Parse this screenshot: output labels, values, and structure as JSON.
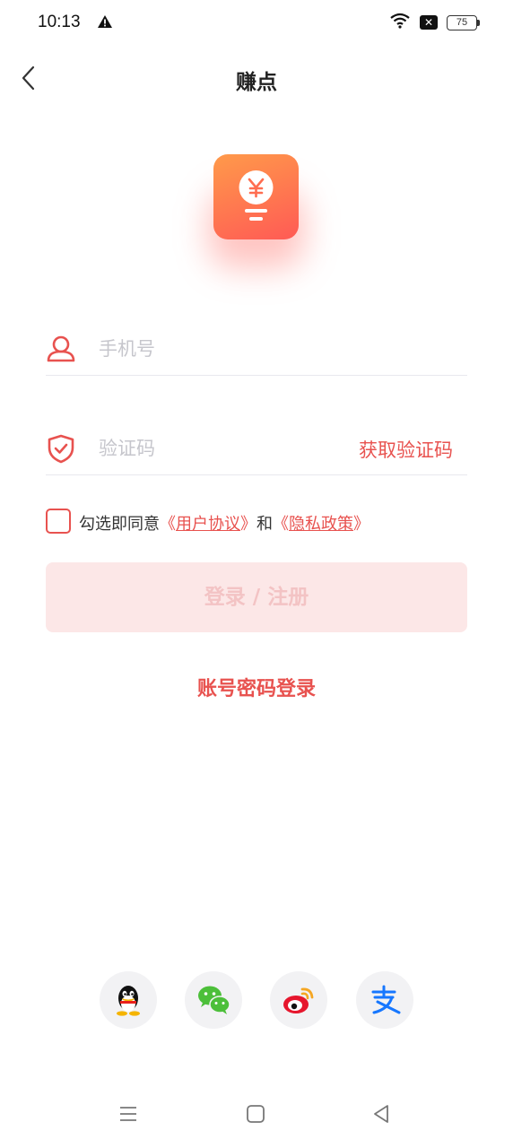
{
  "status_bar": {
    "time": "10:13",
    "battery": "75",
    "icons": [
      "alert-icon",
      "wifi-icon",
      "sim-x-icon",
      "battery-icon"
    ]
  },
  "header": {
    "title": "赚点",
    "back_icon": "chevron-left-icon"
  },
  "logo": {
    "icon": "coin-bulb-icon",
    "gradient": [
      "#ff9a4a",
      "#ff5a55"
    ]
  },
  "form": {
    "phone": {
      "placeholder": "手机号",
      "value": "",
      "icon": "user-icon"
    },
    "code": {
      "placeholder": "验证码",
      "value": "",
      "icon": "shield-check-icon",
      "get_code_label": "获取验证码"
    }
  },
  "agreement": {
    "prefix": "勾选即同意",
    "user_agreement": "用户协议",
    "connector": "和",
    "privacy_policy": "隐私政策",
    "checked": false
  },
  "login_button": {
    "label": "登录 / 注册",
    "enabled": false
  },
  "password_login_label": "账号密码登录",
  "social_logins": [
    "qq-icon",
    "wechat-icon",
    "weibo-icon",
    "alipay-icon"
  ],
  "nav_bar": [
    "menu-icon",
    "home-icon",
    "back-triangle-icon"
  ],
  "colors": {
    "accent": "#e8524f",
    "button_disabled_bg": "#fce7e7",
    "button_disabled_text": "#f3c3c4",
    "placeholder": "#c6c6cc"
  }
}
